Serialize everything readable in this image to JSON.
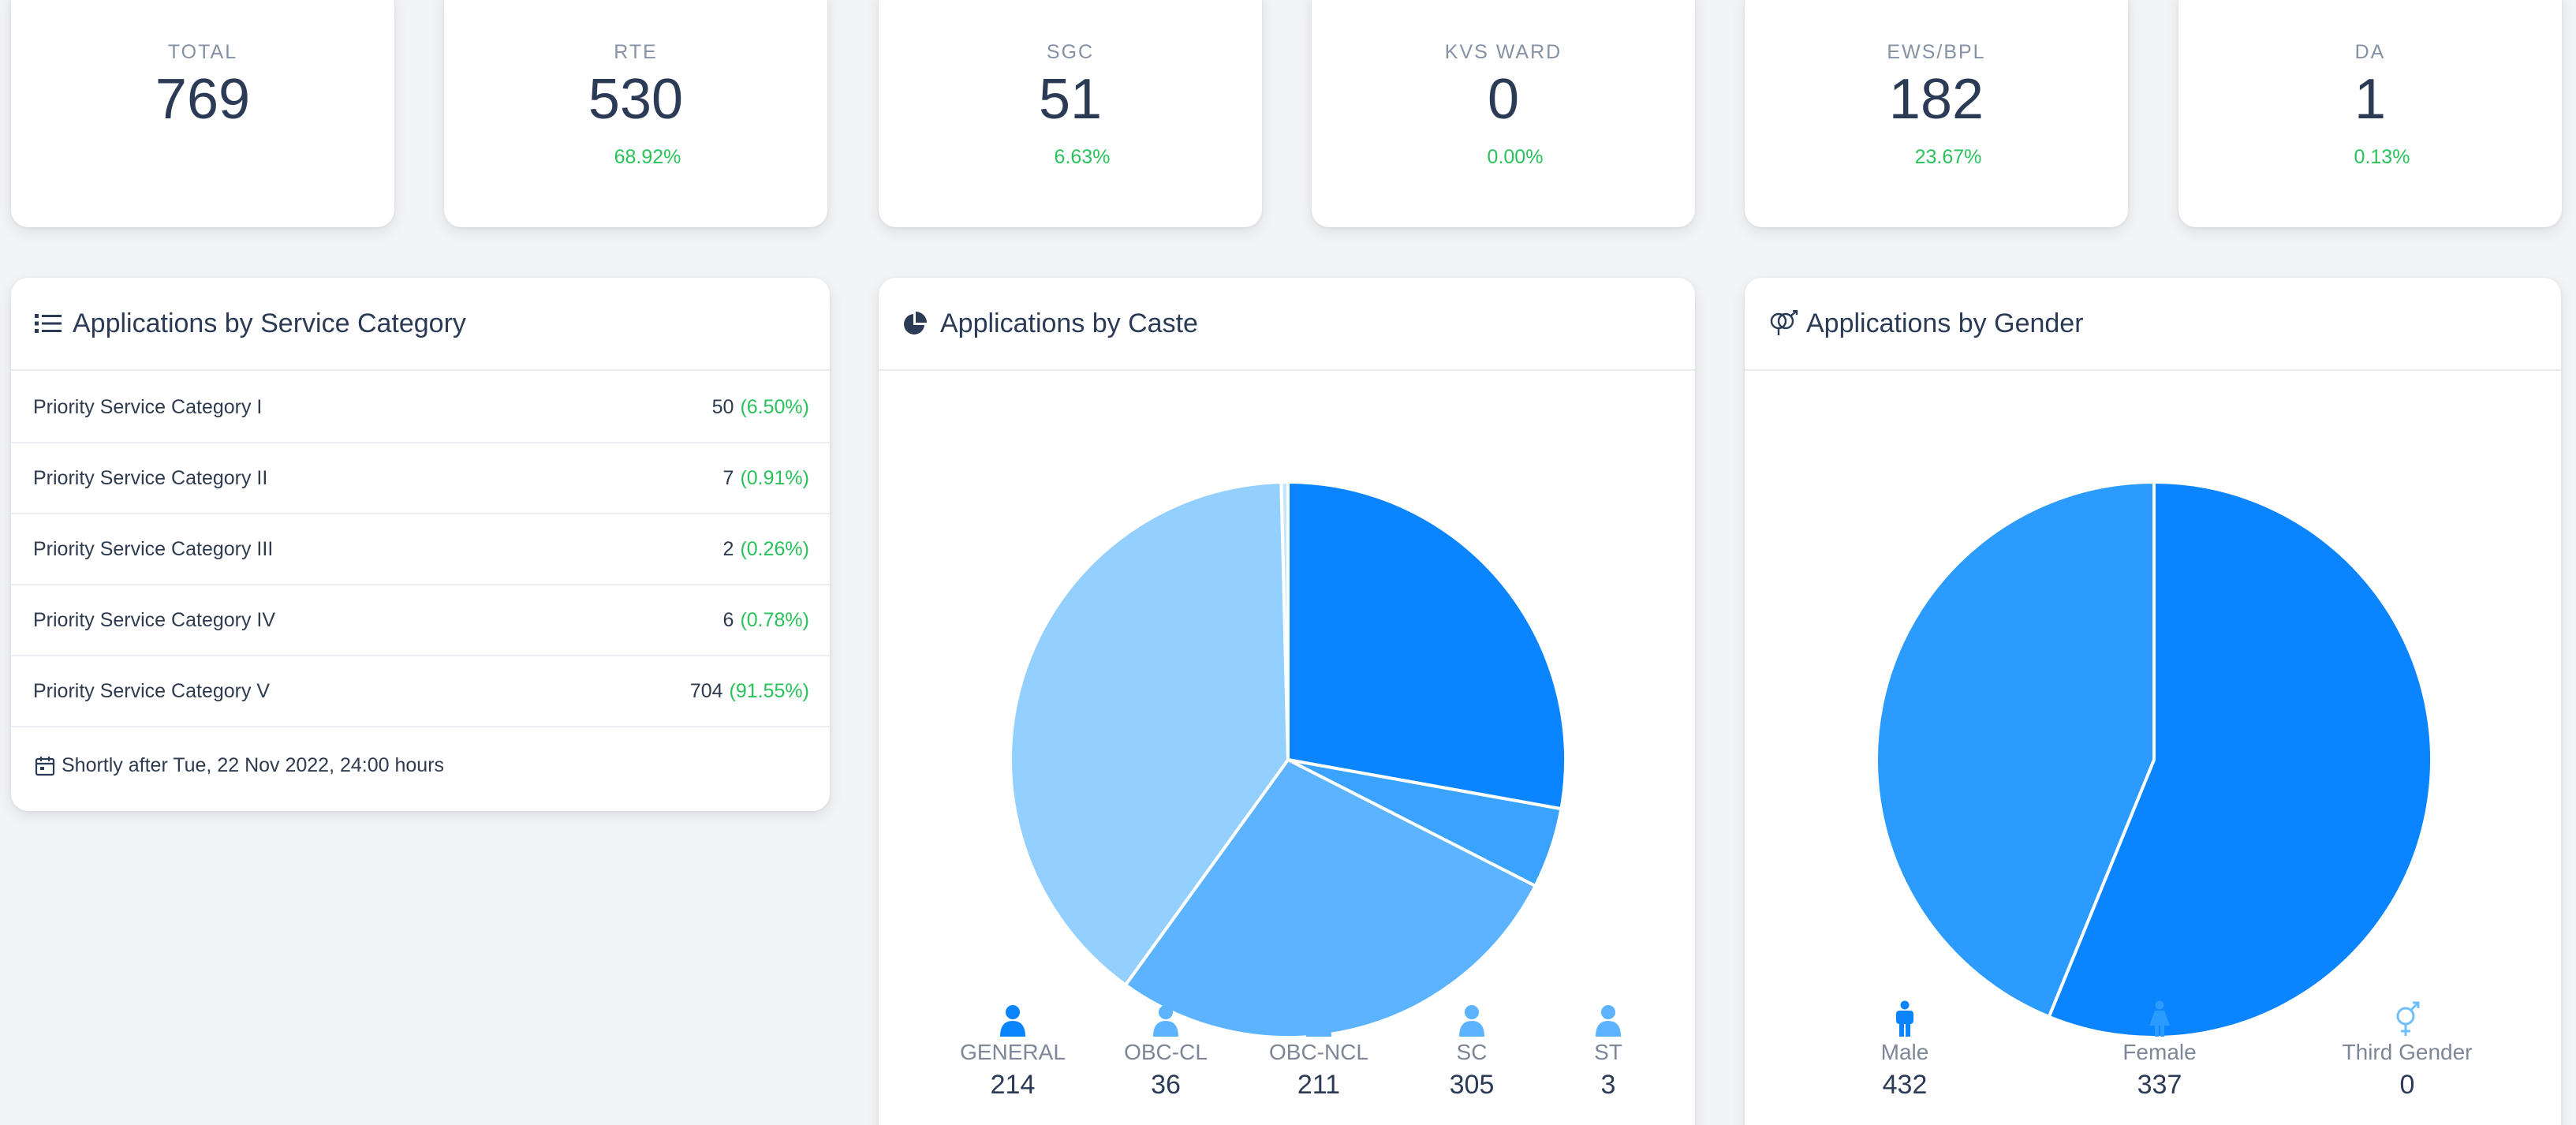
{
  "stats": [
    {
      "label": "TOTAL",
      "value": "769",
      "pct": ""
    },
    {
      "label": "RTE",
      "value": "530",
      "pct": "68.92%"
    },
    {
      "label": "SGC",
      "value": "51",
      "pct": "6.63%"
    },
    {
      "label": "KVS WARD",
      "value": "0",
      "pct": "0.00%"
    },
    {
      "label": "EWS/BPL",
      "value": "182",
      "pct": "23.67%"
    },
    {
      "label": "DA",
      "value": "1",
      "pct": "0.13%"
    }
  ],
  "service": {
    "title": "Applications by Service Category",
    "rows": [
      {
        "name": "Priority Service Category I",
        "count": "50",
        "pct": "(6.50%)"
      },
      {
        "name": "Priority Service Category II",
        "count": "7",
        "pct": "(0.91%)"
      },
      {
        "name": "Priority Service Category III",
        "count": "2",
        "pct": "(0.26%)"
      },
      {
        "name": "Priority Service Category IV",
        "count": "6",
        "pct": "(0.78%)"
      },
      {
        "name": "Priority Service Category V",
        "count": "704",
        "pct": "(91.55%)"
      }
    ],
    "footer": "Shortly after Tue, 22 Nov 2022, 24:00 hours"
  },
  "caste": {
    "title": "Applications by Caste",
    "items": [
      {
        "label": "GENERAL",
        "count": "214",
        "color": "#0a84ff"
      },
      {
        "label": "OBC-CL",
        "count": "36",
        "color": "#3aa2ff"
      },
      {
        "label": "OBC-NCL",
        "count": "211",
        "color": "#5cb3ff"
      },
      {
        "label": "SC",
        "count": "305",
        "color": "#93cfff"
      },
      {
        "label": "ST",
        "count": "3",
        "color": "#c6e6ff"
      }
    ]
  },
  "gender": {
    "title": "Applications by Gender",
    "items": [
      {
        "label": "Male",
        "count": "432",
        "color": "#0a84ff"
      },
      {
        "label": "Female",
        "count": "337",
        "color": "#2b9bff"
      },
      {
        "label": "Third Gender",
        "count": "0",
        "color": "#6ec0ff"
      }
    ]
  },
  "chart_data": [
    {
      "type": "pie",
      "title": "Applications by Caste",
      "categories": [
        "GENERAL",
        "OBC-CL",
        "OBC-NCL",
        "SC",
        "ST"
      ],
      "values": [
        214,
        36,
        211,
        305,
        3
      ]
    },
    {
      "type": "pie",
      "title": "Applications by Gender",
      "categories": [
        "Male",
        "Female",
        "Third Gender"
      ],
      "values": [
        432,
        337,
        0
      ]
    }
  ]
}
